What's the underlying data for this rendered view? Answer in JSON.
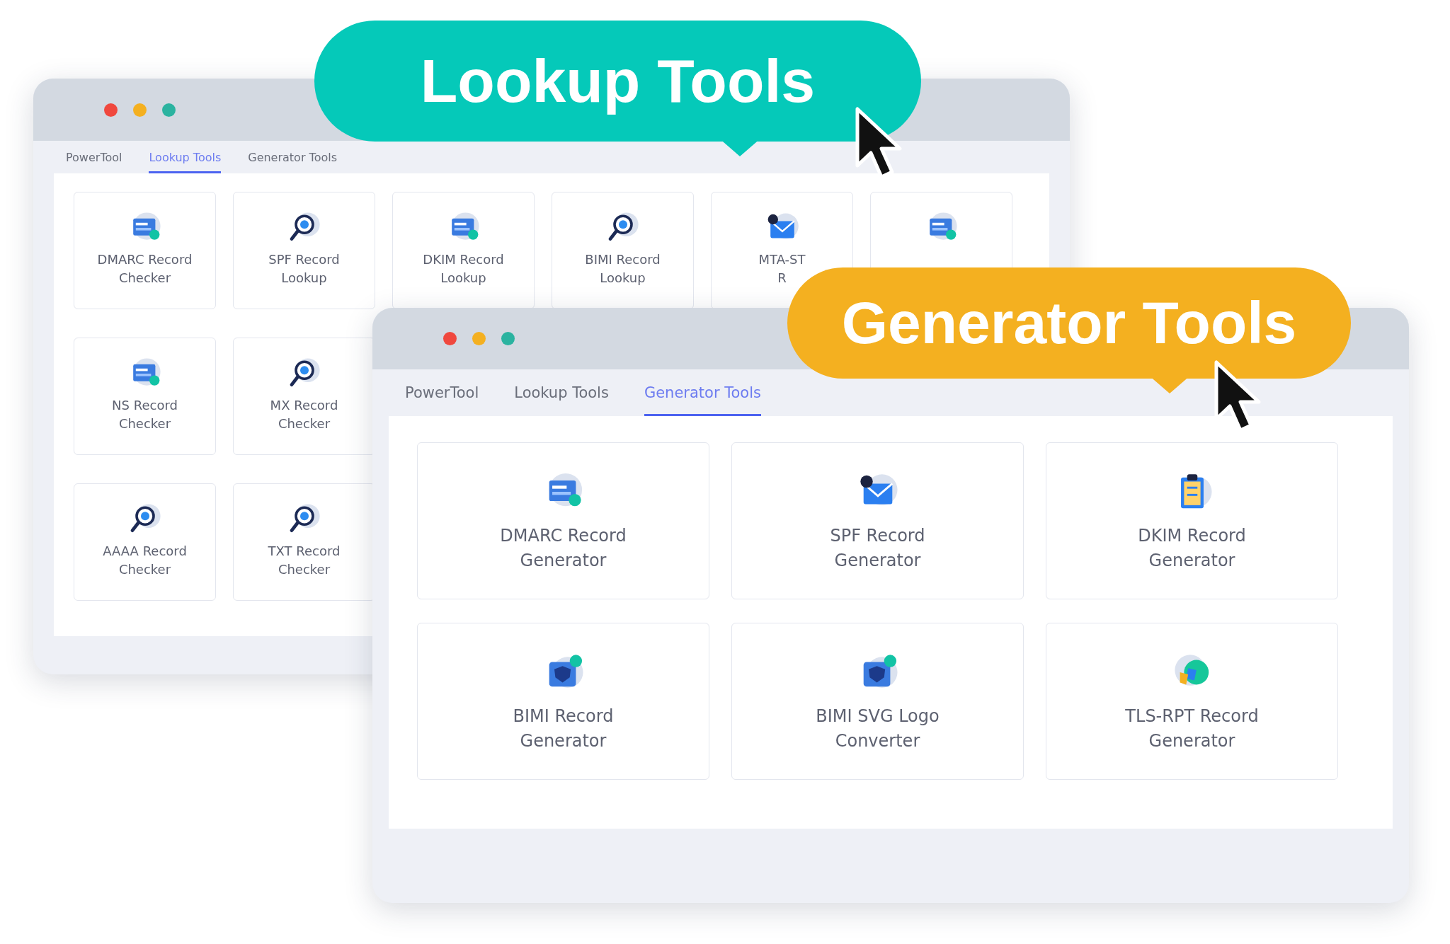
{
  "lookup_window": {
    "tabs": [
      {
        "label": "PowerTool",
        "selected": false
      },
      {
        "label": "Lookup Tools",
        "selected": true
      },
      {
        "label": "Generator Tools",
        "selected": false
      }
    ],
    "rows": [
      [
        {
          "lines": [
            "DMARC Record",
            "Checker"
          ]
        },
        {
          "lines": [
            "SPF Record",
            "Lookup"
          ]
        },
        {
          "lines": [
            "DKIM Record",
            "Lookup"
          ]
        },
        {
          "lines": [
            "BIMI Record",
            "Lookup"
          ]
        },
        {
          "lines": [
            "MTA-ST",
            "R"
          ]
        },
        {}
      ],
      [
        {
          "lines": [
            "NS Record",
            "Checker"
          ]
        },
        {
          "lines": [
            "MX Record",
            "Checker"
          ]
        }
      ],
      [
        {
          "lines": [
            "AAAA Record",
            "Checker"
          ]
        },
        {
          "lines": [
            "TXT Record",
            "Checker"
          ]
        }
      ]
    ]
  },
  "generator_window": {
    "tabs": [
      {
        "label": "PowerTool",
        "selected": false
      },
      {
        "label": "Lookup Tools",
        "selected": false
      },
      {
        "label": "Generator Tools",
        "selected": true
      }
    ],
    "rows": [
      [
        {
          "lines": [
            "DMARC Record",
            "Generator"
          ]
        },
        {
          "lines": [
            "SPF Record",
            "Generator"
          ]
        },
        {
          "lines": [
            "DKIM Record",
            "Generator"
          ]
        }
      ],
      [
        {
          "lines": [
            "BIMI Record",
            "Generator"
          ]
        },
        {
          "lines": [
            "BIMI SVG Logo",
            "Converter"
          ]
        },
        {
          "lines": [
            "TLS-RPT Record",
            "Generator"
          ]
        }
      ]
    ]
  },
  "callouts": [
    {
      "text": "Lookup Tools",
      "color": "#05c9b9"
    },
    {
      "text": "Generator Tools",
      "color": "#f4b020"
    }
  ]
}
